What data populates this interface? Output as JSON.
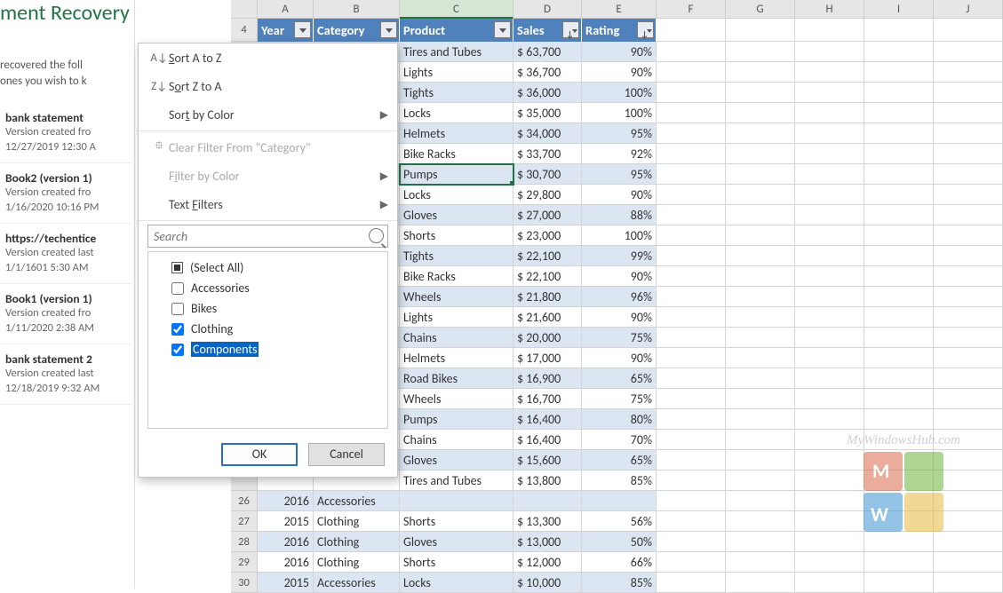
{
  "recovery": {
    "title": "ment Recovery",
    "desc_line1": " recovered the foll",
    "desc_line2": "ones you wish to k",
    "items": [
      {
        "title": "bank statement",
        "sub": "Version created fro",
        "date": "12/27/2019 12:30 A"
      },
      {
        "title": "Book2 (version 1)",
        "sub": "Version created fro",
        "date": "1/16/2020 10:16 PM"
      },
      {
        "title": "https://techentice",
        "sub": "Version created last",
        "date": "1/1/1601 5:30 AM"
      },
      {
        "title": "Book1 (version 1)",
        "sub": "Version created fro",
        "date": "1/11/2020 2:38 AM"
      },
      {
        "title": "bank statement 2",
        "sub": "Version created last",
        "date": "12/18/2019 9:32 AM"
      }
    ]
  },
  "columns": [
    "A",
    "B",
    "C",
    "D",
    "E",
    "F",
    "G",
    "H",
    "I",
    "J"
  ],
  "table_headers": {
    "row_num": "4",
    "year": "Year",
    "category": "Category",
    "product": "Product",
    "sales": "Sales",
    "rating": "Rating"
  },
  "rows": [
    {
      "n": "",
      "year": "",
      "cat": "",
      "product": "Tires and Tubes",
      "sales": "$ 63,700",
      "rating": "90%"
    },
    {
      "n": "",
      "year": "",
      "cat": "",
      "product": "Lights",
      "sales": "$ 36,700",
      "rating": "90%"
    },
    {
      "n": "",
      "year": "",
      "cat": "",
      "product": "Tights",
      "sales": "$ 36,000",
      "rating": "100%"
    },
    {
      "n": "",
      "year": "",
      "cat": "",
      "product": "Locks",
      "sales": "$ 35,000",
      "rating": "100%"
    },
    {
      "n": "",
      "year": "",
      "cat": "",
      "product": "Helmets",
      "sales": "$ 34,000",
      "rating": "95%"
    },
    {
      "n": "",
      "year": "",
      "cat": "",
      "product": "Bike Racks",
      "sales": "$ 33,700",
      "rating": "92%"
    },
    {
      "n": "",
      "year": "",
      "cat": "",
      "product": "Pumps",
      "sales": "$ 30,700",
      "rating": "95%",
      "selected": true
    },
    {
      "n": "",
      "year": "",
      "cat": "",
      "product": "Locks",
      "sales": "$ 29,800",
      "rating": "90%"
    },
    {
      "n": "",
      "year": "",
      "cat": "",
      "product": "Gloves",
      "sales": "$ 27,000",
      "rating": "88%"
    },
    {
      "n": "",
      "year": "",
      "cat": "",
      "product": "Shorts",
      "sales": "$ 23,000",
      "rating": "100%"
    },
    {
      "n": "",
      "year": "",
      "cat": "",
      "product": "Tights",
      "sales": "$ 22,100",
      "rating": "99%"
    },
    {
      "n": "",
      "year": "",
      "cat": "",
      "product": "Bike Racks",
      "sales": "$ 22,100",
      "rating": "90%"
    },
    {
      "n": "",
      "year": "",
      "cat": "",
      "product": "Wheels",
      "sales": "$ 21,800",
      "rating": "96%"
    },
    {
      "n": "",
      "year": "",
      "cat": "",
      "product": "Lights",
      "sales": "$ 21,600",
      "rating": "90%"
    },
    {
      "n": "",
      "year": "",
      "cat": "",
      "product": "Chains",
      "sales": "$ 20,000",
      "rating": "75%"
    },
    {
      "n": "",
      "year": "",
      "cat": "",
      "product": "Helmets",
      "sales": "$ 17,000",
      "rating": "90%"
    },
    {
      "n": "",
      "year": "",
      "cat": "",
      "product": "Road Bikes",
      "sales": "$ 16,900",
      "rating": "65%"
    },
    {
      "n": "",
      "year": "",
      "cat": "",
      "product": "Wheels",
      "sales": "$ 16,700",
      "rating": "75%"
    },
    {
      "n": "",
      "year": "",
      "cat": "",
      "product": "Pumps",
      "sales": "$ 16,400",
      "rating": "80%"
    },
    {
      "n": "",
      "year": "",
      "cat": "",
      "product": "Chains",
      "sales": "$ 16,400",
      "rating": "70%"
    },
    {
      "n": "",
      "year": "",
      "cat": "",
      "product": "Gloves",
      "sales": "$ 15,600",
      "rating": "65%"
    },
    {
      "n": "",
      "year": "",
      "cat": "",
      "product": "Tires and Tubes",
      "sales": "$ 13,800",
      "rating": "85%"
    },
    {
      "n": "26",
      "year": "2016",
      "cat": "Accessories",
      "product": "",
      "sales": "",
      "rating": ""
    },
    {
      "n": "27",
      "year": "2015",
      "cat": "Clothing",
      "product": "Shorts",
      "sales": "$ 13,300",
      "rating": "56%"
    },
    {
      "n": "28",
      "year": "2016",
      "cat": "Clothing",
      "product": "Gloves",
      "sales": "$ 13,000",
      "rating": "50%"
    },
    {
      "n": "29",
      "year": "2016",
      "cat": "Clothing",
      "product": "Shorts",
      "sales": "$ 12,000",
      "rating": "66%"
    },
    {
      "n": "30",
      "year": "2015",
      "cat": "Accessories",
      "product": "Locks",
      "sales": "$ 10,000",
      "rating": "85%"
    }
  ],
  "filter_menu": {
    "sort_az": "Sort A to Z",
    "sort_za": "Sort Z to A",
    "sort_color": "Sort by Color",
    "clear_filter": "Clear Filter From \"Category\"",
    "filter_color": "Filter by Color",
    "text_filters": "Text Filters",
    "search_placeholder": "Search",
    "select_all": "(Select All)",
    "options": [
      {
        "label": "Accessories",
        "checked": false
      },
      {
        "label": "Bikes",
        "checked": false
      },
      {
        "label": "Clothing",
        "checked": true
      },
      {
        "label": "Components",
        "checked": true,
        "highlighted": true
      }
    ],
    "ok": "OK",
    "cancel": "Cancel"
  },
  "watermark": "MyWindowsHub.com"
}
